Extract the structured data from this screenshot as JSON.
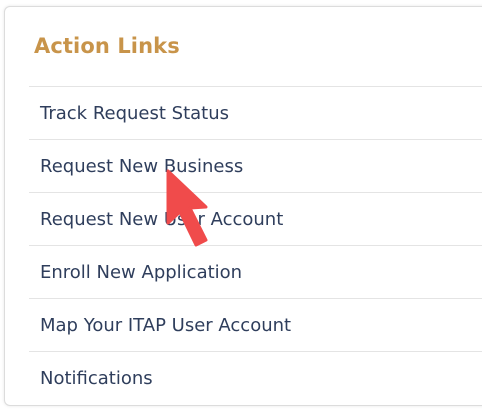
{
  "colors": {
    "title": "#c8944a",
    "link": "#2f3e5c",
    "cursor": "#f04b4b"
  },
  "panel": {
    "title": "Action Links",
    "links": [
      {
        "label": "Track Request Status"
      },
      {
        "label": "Request New Business"
      },
      {
        "label": "Request New User Account"
      },
      {
        "label": "Enroll New Application"
      },
      {
        "label": "Map Your ITAP User Account"
      },
      {
        "label": "Notifications"
      }
    ]
  },
  "cursor": {
    "icon": "arrow-cursor-icon"
  }
}
